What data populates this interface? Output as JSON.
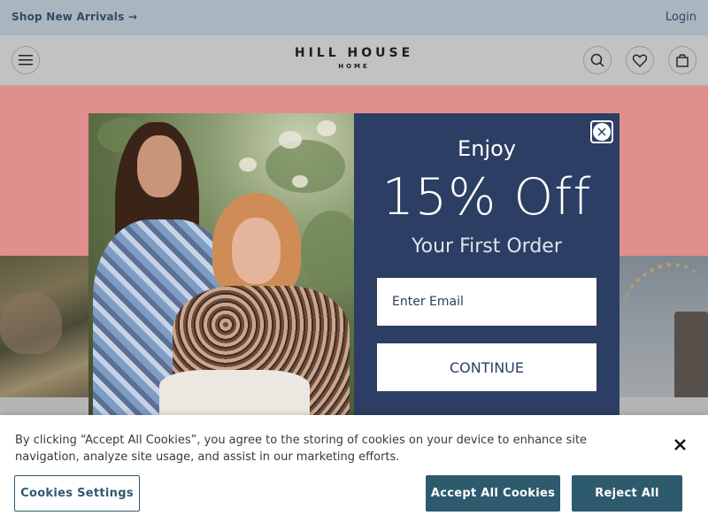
{
  "promo_bar": {
    "link_label": "Shop New Arrivals →",
    "login_label": "Login"
  },
  "header": {
    "logo_main": "HILL HOUSE",
    "logo_sub": "HOME",
    "icons": [
      "menu-icon",
      "search-icon",
      "heart-icon",
      "bag-icon"
    ]
  },
  "modal": {
    "headline": "Enjoy",
    "discount": "15% Off",
    "subhead": "Your First Order",
    "email_placeholder": "Enter Email",
    "email_value": "",
    "continue_label": "CONTINUE",
    "panel_color": "#2c3e63"
  },
  "cookie_banner": {
    "text": "By clicking “Accept All Cookies”, you agree to the storing of cookies on your device to enhance site navigation, analyze site usage, and assist in our marketing efforts.",
    "settings_label": "Cookies Settings",
    "accept_label": "Accept All Cookies",
    "reject_label": "Reject All",
    "button_color": "#2d5a6d"
  },
  "colors": {
    "promo_bg": "#a9b6bf",
    "header_bg": "#c2c2c2",
    "hero_pink": "#e08e8e"
  }
}
